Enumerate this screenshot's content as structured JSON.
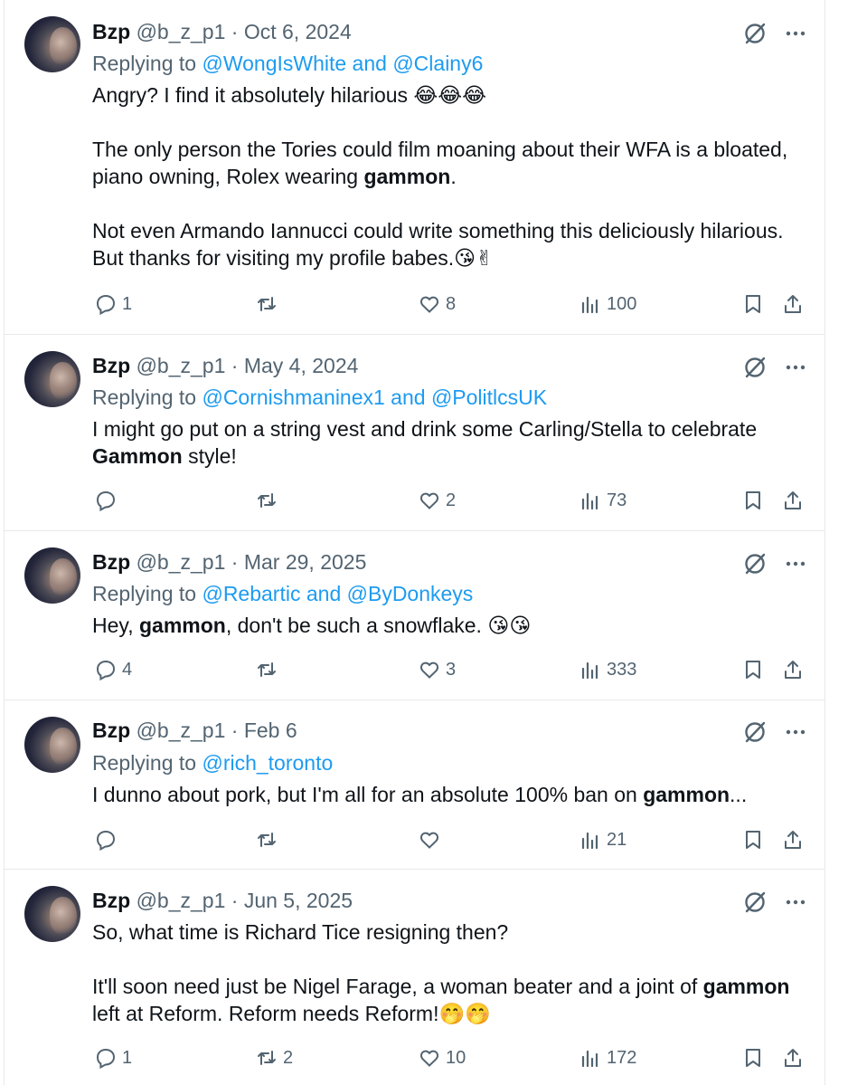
{
  "tweets": [
    {
      "name": "Bzp",
      "handle": "@b_z_p1",
      "separator": "·",
      "date": "Oct 6, 2024",
      "replying_prefix": "Replying to ",
      "mention1": "@WongIsWhite",
      "joiner": " and ",
      "mention2": "@Clainy6",
      "p1": "Angry? I find it absolutely hilarious 😂😂😂",
      "p2a": "The only person the Tories could film moaning about their WFA is a bloated, piano owning, Rolex wearing ",
      "p2b": "gammon",
      "p2c": ".",
      "p3": "Not even Armando Iannucci could write something this deliciously hilarious. But thanks for visiting my profile babes.😘✌",
      "replies": "1",
      "retweets": "",
      "likes": "8",
      "views": "100"
    },
    {
      "name": "Bzp",
      "handle": "@b_z_p1",
      "separator": "·",
      "date": "May 4, 2024",
      "replying_prefix": "Replying to ",
      "mention1": "@Cornishmaninex1",
      "joiner": " and ",
      "mention2": "@PolitlcsUK",
      "p1a": "I might go put on a string vest and drink some Carling/Stella to celebrate ",
      "p1b": "Gammon",
      "p1c": " style!",
      "replies": "",
      "retweets": "",
      "likes": "2",
      "views": "73"
    },
    {
      "name": "Bzp",
      "handle": "@b_z_p1",
      "separator": "·",
      "date": "Mar 29, 2025",
      "replying_prefix": "Replying to ",
      "mention1": "@Rebartic",
      "joiner": " and ",
      "mention2": "@ByDonkeys",
      "p1a": "Hey, ",
      "p1b": "gammon",
      "p1c": ", don't be such a snowflake. 😘😘",
      "replies": "4",
      "retweets": "",
      "likes": "3",
      "views": "333"
    },
    {
      "name": "Bzp",
      "handle": "@b_z_p1",
      "separator": "·",
      "date": "Feb 6",
      "replying_prefix": "Replying to ",
      "mention1": "@rich_toronto",
      "p1a": "I dunno about pork, but I'm all for an absolute 100% ban on ",
      "p1b": "gammon",
      "p1c": "...",
      "replies": "",
      "retweets": "",
      "likes": "",
      "views": "21"
    },
    {
      "name": "Bzp",
      "handle": "@b_z_p1",
      "separator": "·",
      "date": "Jun 5, 2025",
      "p1": "So, what time is Richard Tice resigning then?",
      "p2a": "It'll soon need just be Nigel Farage, a woman beater and a joint of ",
      "p2b": "gammon",
      "p2c": " left at Reform. Reform needs Reform!🤭🤭",
      "replies": "1",
      "retweets": "2",
      "likes": "10",
      "views": "172"
    }
  ],
  "icons": {
    "grok": "grok-icon",
    "more": "more-icon",
    "reply": "reply-icon",
    "retweet": "retweet-icon",
    "like": "heart-icon",
    "views": "views-icon",
    "bookmark": "bookmark-icon",
    "share": "share-icon"
  },
  "colors": {
    "text": "#0f1419",
    "secondary": "#536471",
    "link": "#1d9bf0",
    "divider": "#e7e9ea"
  }
}
